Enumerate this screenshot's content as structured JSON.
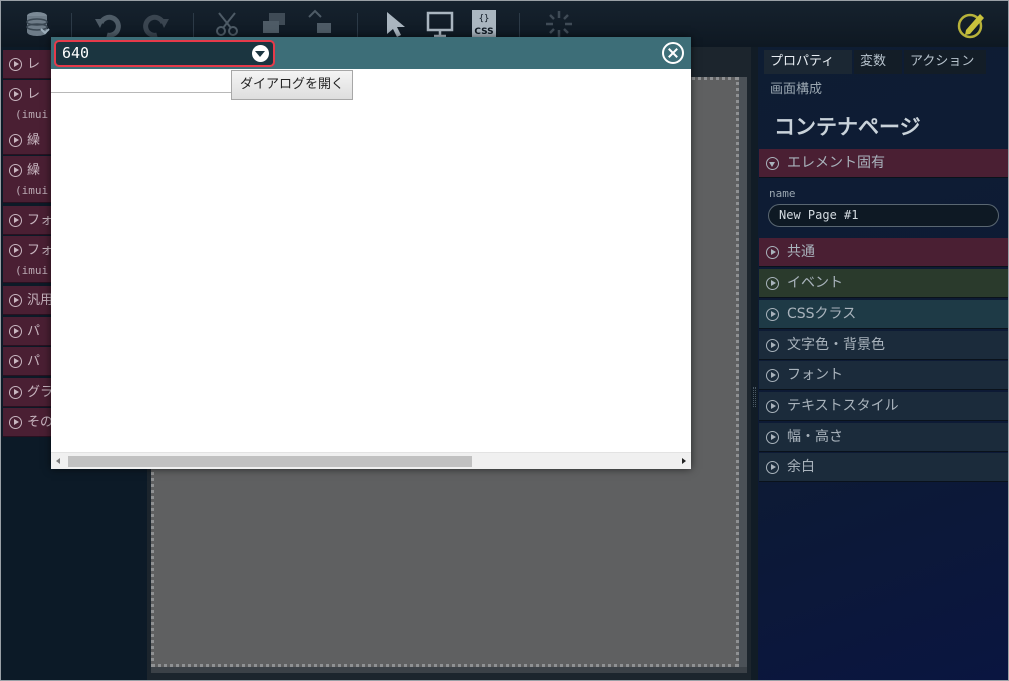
{
  "toolbar": {
    "icons": [
      "database-icon",
      "undo-icon",
      "redo-icon",
      "cut-icon",
      "copy-icon",
      "paste-icon",
      "pointer-icon",
      "preview-icon",
      "css-icon",
      "loading-icon",
      "edit-icon"
    ],
    "css_label": "CSS",
    "css_braces": "{}"
  },
  "palette": {
    "items": [
      {
        "label": "レ",
        "sub": ""
      },
      {
        "label": "レ",
        "sub": "(imui"
      },
      {
        "label": "繰",
        "sub": ""
      },
      {
        "label": "繰",
        "sub": "(imui"
      },
      {
        "label": "フォ",
        "sub": ""
      },
      {
        "label": "フォ",
        "sub": "(imui"
      },
      {
        "label": "汎用",
        "sub": ""
      },
      {
        "label": "パ",
        "sub": ""
      },
      {
        "label": "パ",
        "sub": ""
      },
      {
        "label": "グラ",
        "sub": ""
      },
      {
        "label": "その",
        "sub": ""
      }
    ]
  },
  "dialog": {
    "size_value": "640",
    "open_button_label": "ダイアログを開く",
    "text_input_value": ""
  },
  "props": {
    "tabs": [
      "プロパティ",
      "変数",
      "アクション"
    ],
    "subtab": "画面構成",
    "title": "コンテナページ",
    "sections": [
      {
        "label": "エレメント固有",
        "expanded": true,
        "color": "#4a1f33"
      },
      {
        "label": "共通",
        "expanded": false,
        "color": "#4a1f33"
      },
      {
        "label": "イベント",
        "expanded": false,
        "color": "#2a3a2c"
      },
      {
        "label": "CSSクラス",
        "expanded": false,
        "color": "#1e3a46"
      },
      {
        "label": "文字色・背景色",
        "expanded": false,
        "color": "#1b2b3b"
      },
      {
        "label": "フォント",
        "expanded": false,
        "color": "#1b2b3b"
      },
      {
        "label": "テキストスタイル",
        "expanded": false,
        "color": "#1b2b3b"
      },
      {
        "label": "幅・高さ",
        "expanded": false,
        "color": "#1b2b3b"
      },
      {
        "label": "余白",
        "expanded": false,
        "color": "#1b2b3b"
      }
    ],
    "name_field": {
      "label": "name",
      "value": "New Page #1"
    }
  }
}
